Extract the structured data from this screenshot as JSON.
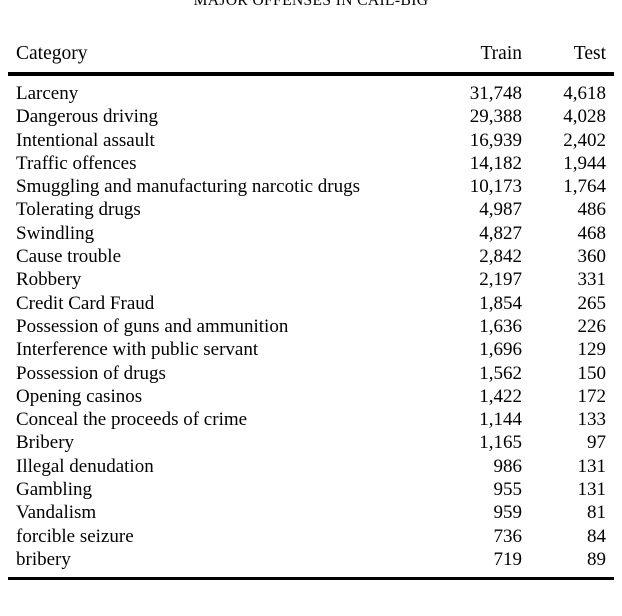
{
  "caption": {
    "text": "MAJOR OFFENSES IN CAIL-BIG"
  },
  "table": {
    "columns": {
      "category": "Category",
      "train": "Train",
      "test": "Test"
    },
    "rows": [
      {
        "category": "Larceny",
        "train": "31,748",
        "test": "4,618"
      },
      {
        "category": "Dangerous driving",
        "train": "29,388",
        "test": "4,028"
      },
      {
        "category": "Intentional assault",
        "train": "16,939",
        "test": "2,402"
      },
      {
        "category": "Traffic offences",
        "train": "14,182",
        "test": "1,944"
      },
      {
        "category": "Smuggling and manufacturing narcotic drugs",
        "train": "10,173",
        "test": "1,764"
      },
      {
        "category": "Tolerating drugs",
        "train": "4,987",
        "test": "486"
      },
      {
        "category": "Swindling",
        "train": "4,827",
        "test": "468"
      },
      {
        "category": "Cause trouble",
        "train": "2,842",
        "test": "360"
      },
      {
        "category": "Robbery",
        "train": "2,197",
        "test": "331"
      },
      {
        "category": "Credit Card Fraud",
        "train": "1,854",
        "test": "265"
      },
      {
        "category": "Possession of guns and ammunition",
        "train": "1,636",
        "test": "226"
      },
      {
        "category": "Interference with public servant",
        "train": "1,696",
        "test": "129"
      },
      {
        "category": "Possession of drugs",
        "train": "1,562",
        "test": "150"
      },
      {
        "category": "Opening casinos",
        "train": "1,422",
        "test": "172"
      },
      {
        "category": "Conceal the proceeds of crime",
        "train": "1,144",
        "test": "133"
      },
      {
        "category": "Bribery",
        "train": "1,165",
        "test": "97"
      },
      {
        "category": "Illegal denudation",
        "train": "986",
        "test": "131"
      },
      {
        "category": "Gambling",
        "train": "955",
        "test": "131"
      },
      {
        "category": "Vandalism",
        "train": "959",
        "test": "81"
      },
      {
        "category": "forcible seizure",
        "train": "736",
        "test": "84"
      },
      {
        "category": "bribery",
        "train": "719",
        "test": "89"
      }
    ]
  }
}
